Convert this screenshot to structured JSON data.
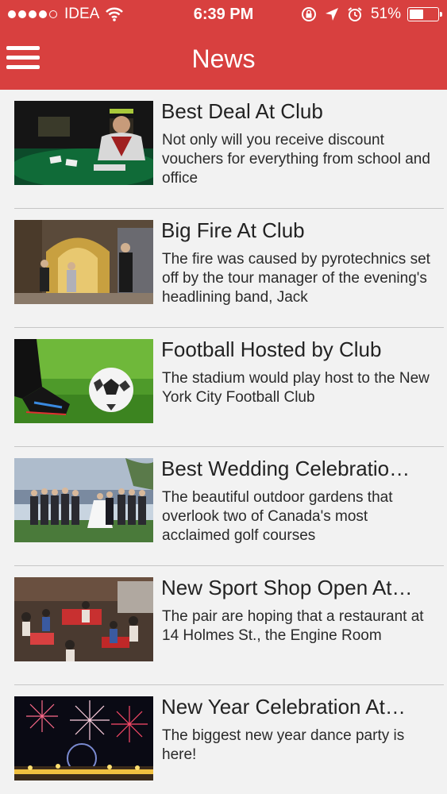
{
  "status_bar": {
    "carrier": "IDEA",
    "time": "6:39 PM",
    "battery_percent": "51%",
    "battery_level": 0.51,
    "signal_bars": 4,
    "signal_max": 5
  },
  "header": {
    "title": "News",
    "background_color": "#d8403f",
    "menu_icon": "hamburger-menu-icon"
  },
  "news": [
    {
      "title": "Best Deal At Club",
      "description": "Not only will you receive discount vouchers for everything from school and office",
      "image": "casino-dealer"
    },
    {
      "title": "Big Fire At Club",
      "description": "The fire was caused by pyrotechnics set off by the tour manager of the evening's headlining band, Jack",
      "image": "club-entrance"
    },
    {
      "title": "Football Hosted by Club",
      "description": "The stadium would play host to the New York City Football Club",
      "image": "football-on-grass"
    },
    {
      "title": "Best Wedding Celebratio…",
      "description": "The beautiful outdoor gardens that overlook two of Canada's most acclaimed golf courses",
      "image": "wedding-group"
    },
    {
      "title": "New Sport Shop Open At…",
      "description": "The pair are hoping that a restaurant at 14 Holmes St., the Engine Room",
      "image": "crowded-shop"
    },
    {
      "title": "New Year Celebration At…",
      "description": "The biggest new year dance party is here!",
      "image": "fireworks"
    }
  ]
}
